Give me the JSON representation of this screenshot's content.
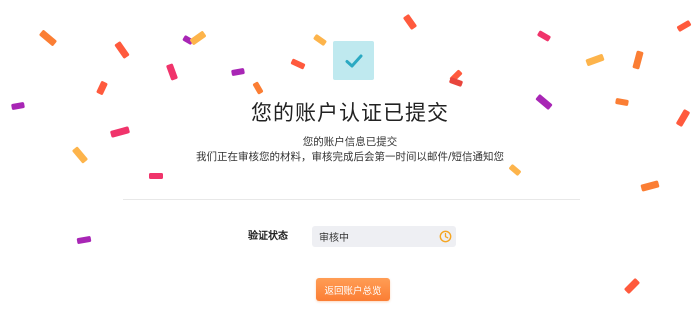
{
  "page": {
    "title": "您的账户认证已提交",
    "subtitle": "您的账户信息已提交",
    "description": "我们正在审核您的材料，审核完成后会第一时间以邮件/短信通知您"
  },
  "status": {
    "label": "验证状态",
    "value": "审核中",
    "icon": "clock-icon"
  },
  "actions": {
    "back_button": "返回账户总览"
  },
  "icons": {
    "success": "checkmark-icon",
    "pending": "clock-icon"
  },
  "colors": {
    "accent": "#fb8a3c",
    "check_bg": "#bfe9ef",
    "check_mark": "#2ba9c2",
    "field_bg": "#eeeff3",
    "confetti": [
      "#fb7e34",
      "#ff5a3d",
      "#f0346b",
      "#a826b5",
      "#fdb44b",
      "#e8453c"
    ]
  }
}
